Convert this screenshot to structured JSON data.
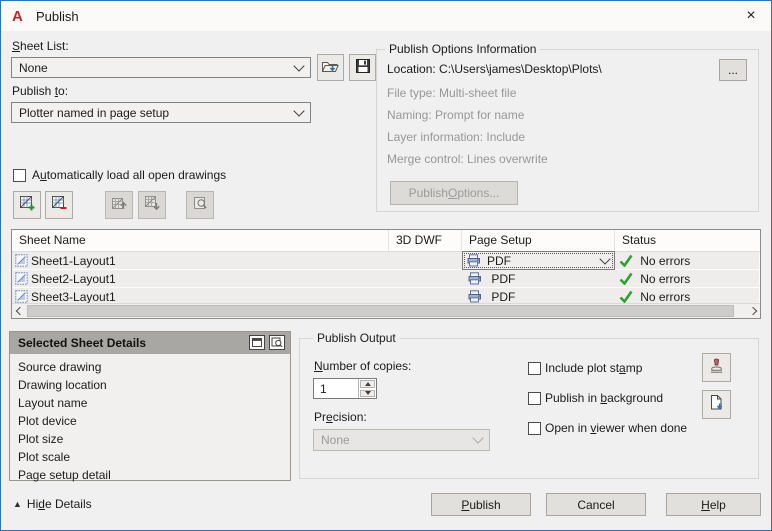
{
  "window": {
    "title": "Publish",
    "close_glyph": "×",
    "logo_glyph": "A"
  },
  "sheet_list": {
    "label": {
      "pre": "",
      "u": "S",
      "post": "heet List:"
    },
    "value": "None"
  },
  "publish_to": {
    "label": {
      "pre": "Publish ",
      "u": "t",
      "post": "o:"
    },
    "value": "Plotter named in page setup"
  },
  "auto_load": {
    "pre": "A",
    "u": "u",
    "post": "tomatically load all open drawings"
  },
  "publish_options": {
    "group_title": "Publish Options Information",
    "location": "Location: C:\\Users\\james\\Desktop\\Plots\\",
    "file_type": "File type: Multi-sheet file",
    "naming": "Naming: Prompt for name",
    "layer_info": "Layer information: Include",
    "merge_control": "Merge control: Lines overwrite",
    "browse_label": "...",
    "button": {
      "pre": "Publish ",
      "u": "O",
      "post": "ptions..."
    }
  },
  "table": {
    "columns": [
      "Sheet Name",
      "3D DWF",
      "Page Setup",
      "Status"
    ],
    "rows": [
      {
        "sheet": "Sheet1-Layout1",
        "dwf": "",
        "page_setup": "PDF",
        "status": "No errors"
      },
      {
        "sheet": "Sheet2-Layout1",
        "dwf": "",
        "page_setup": "PDF",
        "status": "No errors"
      },
      {
        "sheet": "Sheet3-Layout1",
        "dwf": "",
        "page_setup": "PDF",
        "status": "No errors"
      }
    ]
  },
  "details": {
    "title": "Selected Sheet Details",
    "items": [
      "Source drawing",
      "Drawing location",
      "Layout name",
      "Plot device",
      "Plot size",
      "Plot scale",
      "Page setup detail"
    ]
  },
  "output": {
    "group_title": "Publish Output",
    "copies_label": {
      "pre": "",
      "u": "N",
      "post": "umber of copies:"
    },
    "copies_value": "1",
    "precision_label": {
      "pre": "Pr",
      "u": "e",
      "post": "cision:"
    },
    "precision_value": "None",
    "checkboxes": [
      {
        "pre": "Include plot st",
        "u": "a",
        "post": "mp"
      },
      {
        "pre": "Publish in ",
        "u": "b",
        "post": "ackground"
      },
      {
        "pre": "Open in ",
        "u": "v",
        "post": "iewer when done"
      }
    ]
  },
  "footer": {
    "hide_details": {
      "arrow": "▲",
      "pre": "Hi",
      "u": "d",
      "post": "e Details"
    },
    "publish": {
      "pre": "",
      "u": "P",
      "post": "ublish"
    },
    "cancel": "Cancel",
    "help": {
      "pre": "",
      "u": "H",
      "post": "elp"
    }
  },
  "colors": {
    "window_border": "#2b74b5",
    "check_green": "#2da32d",
    "logo_red": "#b92a2e",
    "dialog_bg": "#f0f0f0"
  }
}
